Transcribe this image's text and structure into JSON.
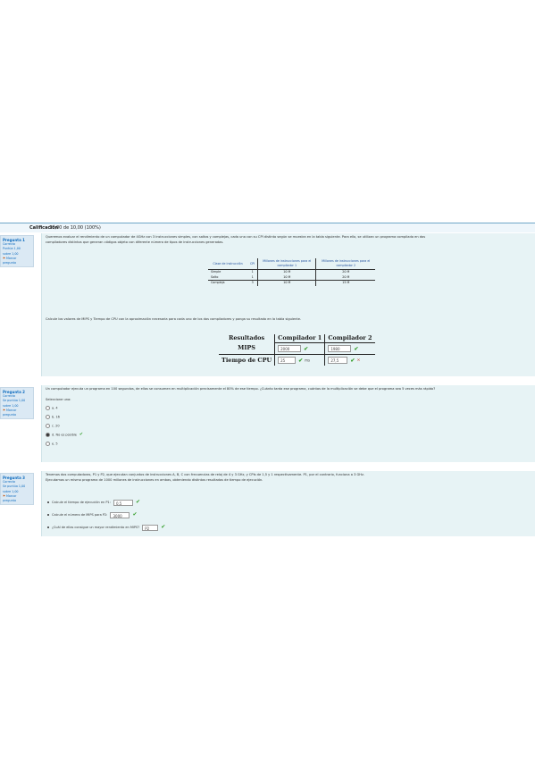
{
  "grade": {
    "label": "Calificación",
    "value": "10,00 de 10,00 (100%)"
  },
  "q1": {
    "info": {
      "title": "Pregunta 1",
      "status": "Correcta",
      "score_line1": "Puntúa 1,00",
      "score_line2": "sobre 1,00",
      "flag": "Marcar",
      "flag_line2": "pregunta"
    },
    "statement_1": "Queremos evaluar el rendimiento de un computador de 4GHz con 3 instrucciones simples, con saltos y complejas, cada una con su CPI distinto según se muestra en la tabla siguiente. Para ello, se utilizan un programa compilado en dos",
    "statement_2": "compiladores distintos que generan códigos objeto con diferente número de tipos de instrucciones generadas.",
    "table1": {
      "headers": [
        "Clase de instrucción",
        "CPI",
        "Millones de instrucciones para el compilador 1",
        "Millones de instrucciones para el compilador 2"
      ],
      "rows": [
        [
          "Simple",
          "1",
          "10 M",
          "20 M"
        ],
        [
          "Salto",
          "1",
          "10 M",
          "20 M"
        ],
        [
          "Compleja",
          "3",
          "10 M",
          "15 M"
        ]
      ]
    },
    "statement_3": "Calcule los valores de MIPS y Tiempo de CPU con la aproximación necesaria para cada uno de los dos compiladores y ponga su resultado en la tabla siguiente.",
    "table2": {
      "headers": [
        "Resultados",
        "Compilador 1",
        "Compilador 2"
      ],
      "rows": [
        {
          "label": "MIPS",
          "c1": "2000",
          "c2": "1980"
        },
        {
          "label": "Tiempo de CPU",
          "c1": "25",
          "c1_unit": "ms",
          "c2": "27,5"
        }
      ]
    }
  },
  "q2": {
    "info": {
      "title": "Pregunta 2",
      "status": "Correcta",
      "score_line1": "Se puntúa 1,00",
      "score_line2": "sobre 1,00",
      "flag": "Marcar",
      "flag_line2": "pregunta"
    },
    "statement": "Un computador ejecuta un programa en 100 segundos, de ellos se consumen en multiplicación precisamente el 80% de ese tiempo. ¿Cuánto tarda ese programa, cuántas de la multiplicación se debe que el programa sea 5 veces más rápido?",
    "select_label": "Seleccione una:",
    "options": [
      {
        "label": "a. 4",
        "selected": false
      },
      {
        "label": "b. 16",
        "selected": false
      },
      {
        "label": "c. 20",
        "selected": false
      },
      {
        "label": "d. No es posible",
        "selected": true
      },
      {
        "label": "e. 5",
        "selected": false
      }
    ]
  },
  "q3": {
    "info": {
      "title": "Pregunta 3",
      "status": "Correcta",
      "score_line1": "Se puntúa 1,00",
      "score_line2": "sobre 1,00",
      "flag": "Marcar",
      "flag_line2": "pregunta"
    },
    "statement_1": "Tenemos dos computadoras, P1 y P2, que ejecutan conjuntos de instrucciones A, B, C con frecuencias de reloj de 4 y 3 GHz, y CPIs de 1,5 y 1 respectivamente. P1, por el contrario, funciona a 3 GHz.",
    "statement_2": "Ejecutamos un mismo programa de 1000 millones de instrucciones en ambas, obteniendo distintos resultados de tiempo de ejecución.",
    "items": [
      {
        "label": "Calcule el tiempo de ejecución en P1:",
        "value": "0,5"
      },
      {
        "label": "Calcule el número de MIPS para P2:",
        "value": "3000"
      },
      {
        "label": "¿Cuál de ellas consigue un mayor rendimiento en MIPS?",
        "value": "P2"
      }
    ]
  }
}
